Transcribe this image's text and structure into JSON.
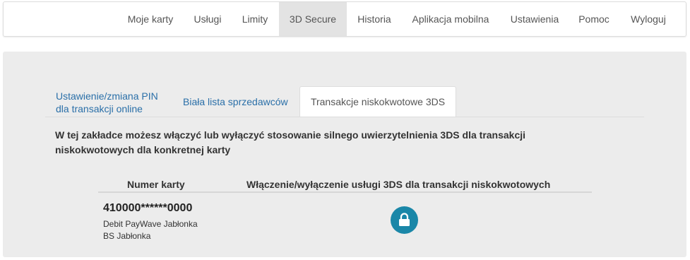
{
  "nav": {
    "items": [
      {
        "label": "Moje karty"
      },
      {
        "label": "Usługi"
      },
      {
        "label": "Limity"
      },
      {
        "label": "3D Secure"
      },
      {
        "label": "Historia"
      },
      {
        "label": "Aplikacja mobilna"
      },
      {
        "label": "Ustawienia"
      },
      {
        "label": "Pomoc"
      },
      {
        "label": "Wyloguj"
      }
    ],
    "active": "3D Secure"
  },
  "tabs": {
    "pin_line1": "Ustawienie/zmiana PIN",
    "pin_line2": "dla transakcji online",
    "whitelist": "Biała lista sprzedawców",
    "low_value": "Transakcje niskokwotowe 3DS",
    "active": "Transakcje niskokwotowe 3DS"
  },
  "description": "W tej zakładce możesz włączyć lub wyłączyć stosowanie silnego uwierzytelnienia 3DS dla transakcji niskokwotowych dla konkretnej karty",
  "table": {
    "headers": {
      "card_number": "Numer karty",
      "toggle": "Włączenie/wyłączenie usługi 3DS dla transakcji niskokwotowych"
    },
    "rows": [
      {
        "card_number": "410000******0000",
        "card_name": "Debit PayWave Jabłonka",
        "bank": "BS Jabłonka",
        "toggle_icon": "lock-icon",
        "toggle_color": "#1a87a8"
      }
    ]
  },
  "colors": {
    "link": "#2a6fa8",
    "panel_bg": "#ececec",
    "active_nav_bg": "#e3e3e3"
  }
}
